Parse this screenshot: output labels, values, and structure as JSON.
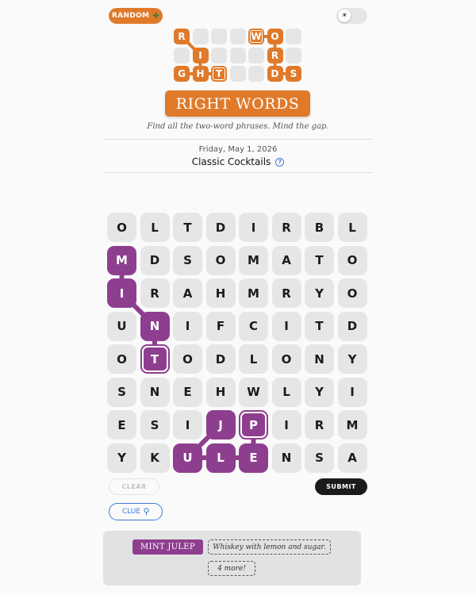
{
  "header": {
    "random_label": "RANDOM",
    "random_icon": "clover-icon",
    "theme_toggle_icon": "sun-icon"
  },
  "logo": {
    "grid": [
      [
        "R",
        "",
        "",
        "",
        "W",
        "O",
        ""
      ],
      [
        "",
        "I",
        "",
        "",
        "",
        "R",
        ""
      ],
      [
        "G",
        "H",
        "T",
        "",
        "",
        "D",
        "S"
      ]
    ],
    "highlight_color": "#e07a2a"
  },
  "title": "RIGHT WORDS",
  "tagline": "Find all the two-word phrases. Mind the gap.",
  "puzzle": {
    "date": "Friday, May 1, 2026",
    "theme": "Classic Cocktails",
    "help_symbol": "?"
  },
  "board": {
    "rows": [
      [
        "O",
        "L",
        "T",
        "D",
        "I",
        "R",
        "B",
        "L"
      ],
      [
        "M",
        "D",
        "S",
        "O",
        "M",
        "A",
        "T",
        "O"
      ],
      [
        "I",
        "R",
        "A",
        "H",
        "M",
        "R",
        "Y",
        "O"
      ],
      [
        "U",
        "N",
        "I",
        "F",
        "C",
        "I",
        "T",
        "D"
      ],
      [
        "O",
        "T",
        "O",
        "D",
        "L",
        "O",
        "N",
        "Y"
      ],
      [
        "S",
        "N",
        "E",
        "H",
        "W",
        "L",
        "Y",
        "I"
      ],
      [
        "E",
        "S",
        "I",
        "J",
        "P",
        "I",
        "R",
        "M"
      ],
      [
        "Y",
        "K",
        "U",
        "L",
        "E",
        "N",
        "S",
        "A"
      ]
    ],
    "selected_color": "#8e3e8f",
    "selected_paths": [
      {
        "word": "MINT",
        "cells": [
          [
            1,
            0
          ],
          [
            2,
            0
          ],
          [
            3,
            1
          ],
          [
            4,
            1
          ]
        ]
      },
      {
        "word": "JULEP",
        "cells": [
          [
            6,
            3
          ],
          [
            7,
            2
          ],
          [
            7,
            3
          ],
          [
            7,
            4
          ],
          [
            6,
            4
          ]
        ]
      }
    ]
  },
  "controls": {
    "clear_label": "CLEAR",
    "submit_label": "SUBMIT",
    "clue_label": "CLUE",
    "clue_icon": "lightbulb-icon"
  },
  "found": {
    "word": "MINT JULEP",
    "hint": "Whiskey with lemon and sugar.",
    "more": "4 more!"
  }
}
